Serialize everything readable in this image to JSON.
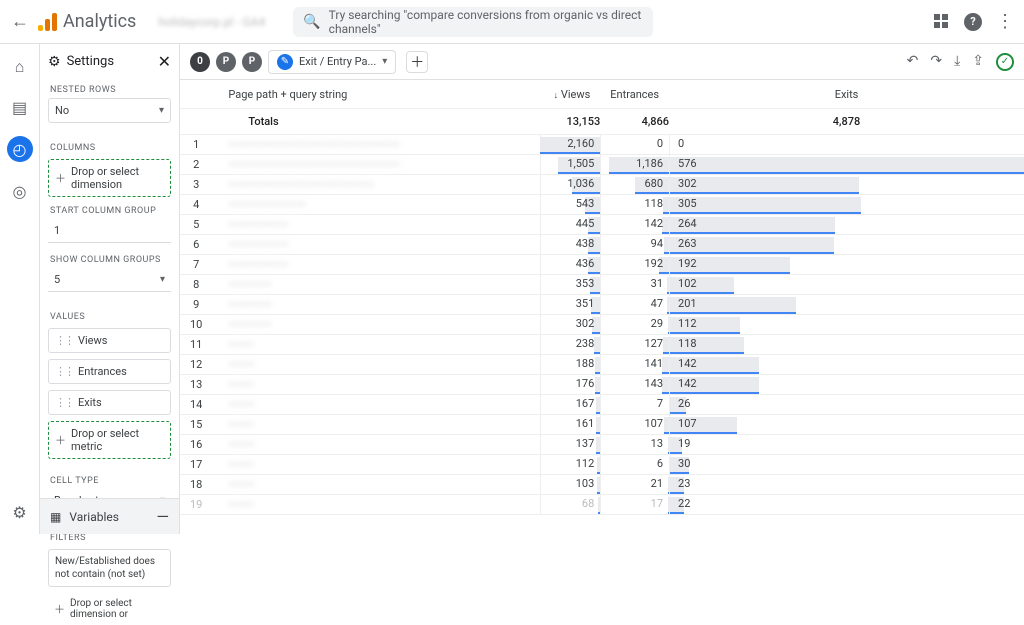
{
  "app": {
    "name": "Analytics",
    "search_placeholder": "Try searching \"compare conversions from organic vs direct channels\""
  },
  "settings": {
    "title": "Settings",
    "nested_rows": {
      "label": "NESTED ROWS",
      "value": "No"
    },
    "columns": {
      "label": "COLUMNS",
      "add_dim": "Drop or select dimension"
    },
    "start_col": {
      "label": "START COLUMN GROUP",
      "value": "1"
    },
    "show_groups": {
      "label": "SHOW COLUMN GROUPS",
      "value": "5"
    },
    "values_label": "VALUES",
    "values": [
      "Views",
      "Entrances",
      "Exits"
    ],
    "add_metric": "Drop or select metric",
    "cell_type": {
      "label": "CELL TYPE",
      "value": "Bar chart"
    },
    "filters": {
      "label": "FILTERS",
      "chip": "New/Established does not contain (not set)",
      "add": "Drop or select dimension or"
    },
    "variables": "Variables"
  },
  "toolbar": {
    "tab": "Exit / Entry Pa..."
  },
  "table": {
    "h_path": "Page path + query string",
    "h_views": "Views",
    "h_entr": "Entrances",
    "h_exits": "Exits",
    "totals_label": "Totals",
    "totals": {
      "views": "13,153",
      "entr": "4,866",
      "exits": "4,878"
    }
  },
  "chart_data": {
    "type": "table-bar",
    "columns": [
      "Views",
      "Entrances",
      "Exits"
    ],
    "totals": [
      13153,
      4866,
      4878
    ],
    "rows": [
      {
        "idx": 1,
        "views": 2160,
        "entr": 0,
        "exits": 0
      },
      {
        "idx": 2,
        "views": 1505,
        "entr": 1186,
        "exits": 576
      },
      {
        "idx": 3,
        "views": 1036,
        "entr": 680,
        "exits": 302
      },
      {
        "idx": 4,
        "views": 543,
        "entr": 118,
        "exits": 305
      },
      {
        "idx": 5,
        "views": 445,
        "entr": 142,
        "exits": 264
      },
      {
        "idx": 6,
        "views": 438,
        "entr": 94,
        "exits": 263
      },
      {
        "idx": 7,
        "views": 436,
        "entr": 192,
        "exits": 192
      },
      {
        "idx": 8,
        "views": 353,
        "entr": 31,
        "exits": 102
      },
      {
        "idx": 9,
        "views": 351,
        "entr": 47,
        "exits": 201
      },
      {
        "idx": 10,
        "views": 302,
        "entr": 29,
        "exits": 112
      },
      {
        "idx": 11,
        "views": 238,
        "entr": 127,
        "exits": 118
      },
      {
        "idx": 12,
        "views": 188,
        "entr": 141,
        "exits": 142
      },
      {
        "idx": 13,
        "views": 176,
        "entr": 143,
        "exits": 142
      },
      {
        "idx": 14,
        "views": 167,
        "entr": 7,
        "exits": 26
      },
      {
        "idx": 15,
        "views": 161,
        "entr": 107,
        "exits": 107
      },
      {
        "idx": 16,
        "views": 137,
        "entr": 13,
        "exits": 19
      },
      {
        "idx": 17,
        "views": 112,
        "entr": 6,
        "exits": 30
      },
      {
        "idx": 18,
        "views": 103,
        "entr": 21,
        "exits": 23
      },
      {
        "idx": 19,
        "views": 68,
        "entr": 17,
        "exits": 22
      }
    ],
    "exits_bar_max": 576
  }
}
